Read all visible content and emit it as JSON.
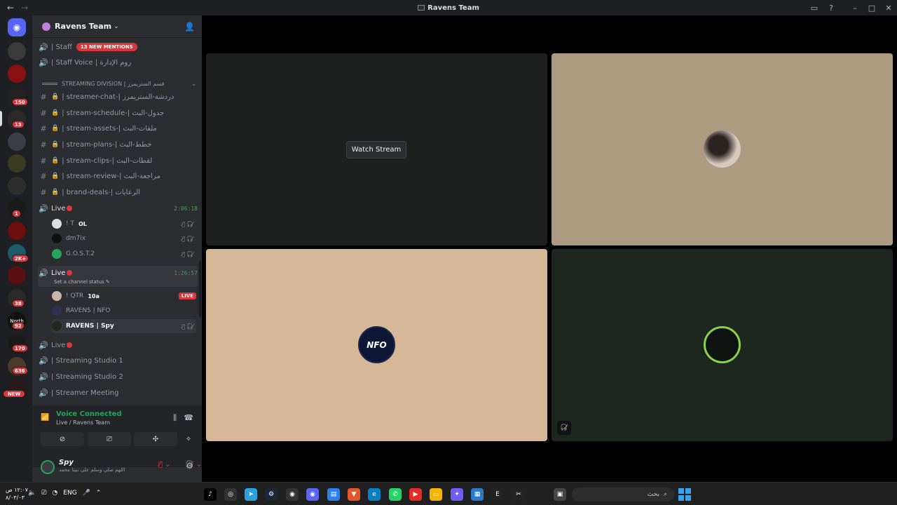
{
  "window": {
    "title": "Ravens Team"
  },
  "server": {
    "name": "Ravens Team"
  },
  "channels": {
    "staff": {
      "name": "| Staff",
      "mentions": "13 NEW MENTIONS"
    },
    "staff_voice": "| Staff Voice | روم الإدارة",
    "category": "STREAMING DIVISION | قسم الستريمرز",
    "text_channels": [
      "| streamer-chat-| دردشة-الستريمرز",
      "| stream-schedule-| جدول-البث",
      "| stream-assets-| ملفات-البث",
      "| stream-plans-| خطط-البث",
      "| stream-clips-| لقطات-البث",
      "| stream-review-| مراجعة-البث",
      "| brand-deals-| الرعايات"
    ],
    "live1": {
      "name": "Live",
      "timer": "2:06:18",
      "users": [
        "! T",
        "dm7ix",
        "G.O.S.T.2"
      ],
      "user0_tag": "OL"
    },
    "live2": {
      "name": "Live",
      "timer": "1:26:57",
      "status_placeholder": "Set a channel status",
      "users": [
        "! QTR",
        "RAVENS | NFO",
        "RAVENS | Spy"
      ],
      "user0_tag": "10a",
      "live_badge": "LIVE"
    },
    "live3": {
      "name": "Live"
    },
    "voice": [
      "| Streaming Studio 1",
      "| Streaming Studio 2",
      "| Streamer Meeting"
    ]
  },
  "server_badges": [
    "150",
    "13",
    "1",
    "2K+",
    "38",
    "92",
    "170",
    "636",
    "NEW"
  ],
  "server_labels": {
    "north": "North"
  },
  "voice_panel": {
    "status": "Voice Connected",
    "location": "Live / Ravens Team"
  },
  "user_panel": {
    "name": "Spy",
    "status": "اللهم صلي وسلم على نبينا محمد"
  },
  "stage": {
    "watch_label": "Watch Stream",
    "tile_labels": {
      "nfo": "NFO"
    }
  },
  "taskbar": {
    "time": "١٢:٠٧ ص",
    "date": "٨/٠٣/٠٣",
    "lang": "ENG",
    "search_placeholder": "بحث"
  }
}
